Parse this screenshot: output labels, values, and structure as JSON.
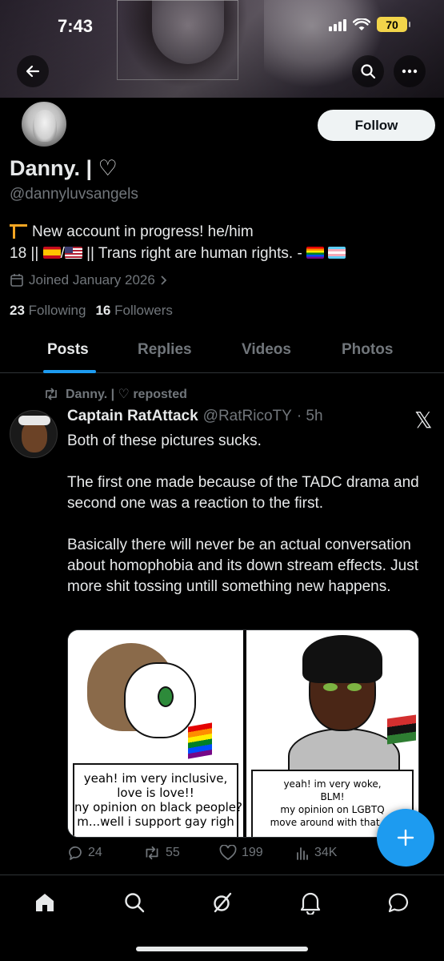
{
  "status_bar": {
    "time": "7:43",
    "battery": "70"
  },
  "profile": {
    "display_name": "Danny. | ♡",
    "handle": "@dannyluvsangels",
    "follow_label": "Follow",
    "bio_line1": "New account in progress! he/him",
    "bio_line2_prefix": "18 || ",
    "bio_line2_mid": "/",
    "bio_line2_suffix": " || Trans right are human rights. - ",
    "joined": "Joined January 2026",
    "following_count": "23",
    "following_label": "Following",
    "followers_count": "16",
    "followers_label": "Followers"
  },
  "tabs": [
    {
      "label": "Posts",
      "active": true
    },
    {
      "label": "Replies",
      "active": false
    },
    {
      "label": "Videos",
      "active": false
    },
    {
      "label": "Photos",
      "active": false
    }
  ],
  "post": {
    "repost_label": "Danny. | ♡ reposted",
    "author": "Captain RatAttack",
    "handle": "@RatRicoTY",
    "time": "· 5h",
    "paragraphs": [
      "Both of these pictures sucks.",
      "The first one made because of the TADC drama and second one was a reaction to the first.",
      "Basically there will never be an actual conversation about homophobia and its down stream effects. Just more shit tossing untill something new happens."
    ],
    "comic_left": {
      "line1": "yeah! im very inclusive,",
      "line2": "love is love!!",
      "line3": "ny opinion on black people?",
      "line4": "m...well i support gay righ"
    },
    "comic_right": {
      "line1": "yeah! im very woke,",
      "line2": "BLM!",
      "line3": "my opinion on LGBTQ",
      "line4": "move around with that ga"
    },
    "stats": {
      "replies": "24",
      "reposts": "55",
      "likes": "199",
      "views": "34K"
    }
  },
  "colors": {
    "accent": "#1d9bf0",
    "background": "#000000",
    "text": "#e7e9ea",
    "muted": "#71767b"
  },
  "icons": [
    "back-arrow-icon",
    "search-icon",
    "more-icon",
    "calendar-icon",
    "repost-icon",
    "x-logo-icon",
    "reply-icon",
    "like-icon",
    "views-icon",
    "home-icon",
    "explore-icon",
    "grok-icon",
    "notifications-icon",
    "messages-icon",
    "plus-icon"
  ]
}
